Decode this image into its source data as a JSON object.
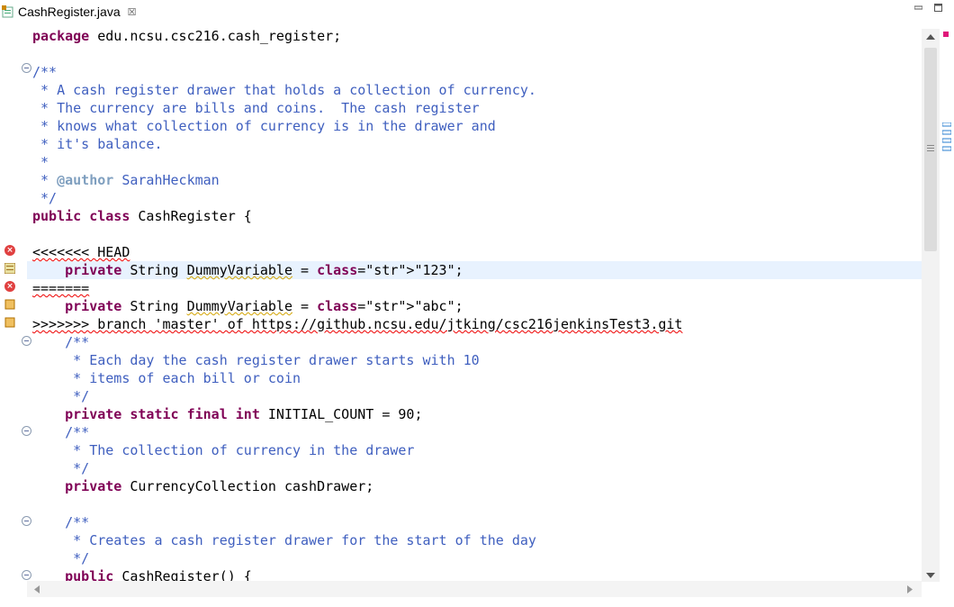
{
  "tab": {
    "title": "CashRegister.java",
    "close_glyph": "☒"
  },
  "code_lines": [
    {
      "text": "package edu.ncsu.csc216.cash_register;"
    },
    {
      "text": ""
    },
    {
      "text": "/**"
    },
    {
      "text": " * A cash register drawer that holds a collection of currency."
    },
    {
      "text": " * The currency are bills and coins.  The cash register"
    },
    {
      "text": " * knows what collection of currency is in the drawer and"
    },
    {
      "text": " * it's balance."
    },
    {
      "text": " *"
    },
    {
      "text": " * @author SarahHeckman"
    },
    {
      "text": " */"
    },
    {
      "text": "public class CashRegister {"
    },
    {
      "text": ""
    },
    {
      "text": "<<<<<<< HEAD"
    },
    {
      "text": "    private String DummyVariable = \"123\";"
    },
    {
      "text": "======="
    },
    {
      "text": "    private String DummyVariable = \"abc\";"
    },
    {
      "text": ">>>>>>> branch 'master' of https://github.ncsu.edu/jtking/csc216jenkinsTest3.git"
    },
    {
      "text": "    /**"
    },
    {
      "text": "     * Each day the cash register drawer starts with 10"
    },
    {
      "text": "     * items of each bill or coin"
    },
    {
      "text": "     */"
    },
    {
      "text": "    private static final int INITIAL_COUNT = 90;"
    },
    {
      "text": "    /**"
    },
    {
      "text": "     * The collection of currency in the drawer"
    },
    {
      "text": "     */"
    },
    {
      "text": "    private CurrencyCollection cashDrawer;"
    },
    {
      "text": ""
    },
    {
      "text": "    /**"
    },
    {
      "text": "     * Creates a cash register drawer for the start of the day"
    },
    {
      "text": "     */"
    },
    {
      "text": "    public CashRegister() {"
    }
  ],
  "colors": {
    "keyword": "#7f0055",
    "comment": "#3f5fbf",
    "string": "#2a00ff",
    "highlight": "#e8f2fe",
    "error": "#e04040"
  },
  "icons": {
    "error": "error-marker-icon",
    "warning": "warning-marker-icon",
    "fold": "fold-toggle-icon",
    "java_file": "java-file-icon"
  }
}
